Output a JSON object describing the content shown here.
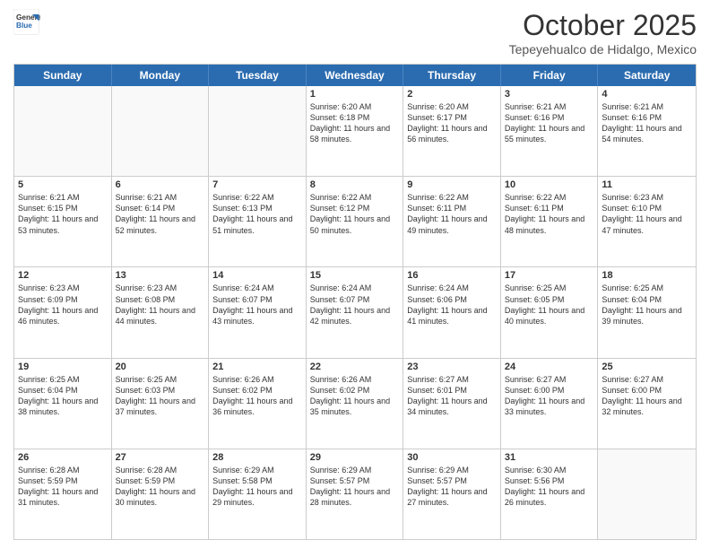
{
  "logo": {
    "line1": "General",
    "line2": "Blue"
  },
  "title": "October 2025",
  "location": "Tepeyehualco de Hidalgo, Mexico",
  "days_of_week": [
    "Sunday",
    "Monday",
    "Tuesday",
    "Wednesday",
    "Thursday",
    "Friday",
    "Saturday"
  ],
  "weeks": [
    [
      {
        "day": "",
        "empty": true
      },
      {
        "day": "",
        "empty": true
      },
      {
        "day": "",
        "empty": true
      },
      {
        "day": "1",
        "sunrise": "6:20 AM",
        "sunset": "6:18 PM",
        "daylight": "11 hours and 58 minutes."
      },
      {
        "day": "2",
        "sunrise": "6:20 AM",
        "sunset": "6:17 PM",
        "daylight": "11 hours and 56 minutes."
      },
      {
        "day": "3",
        "sunrise": "6:21 AM",
        "sunset": "6:16 PM",
        "daylight": "11 hours and 55 minutes."
      },
      {
        "day": "4",
        "sunrise": "6:21 AM",
        "sunset": "6:16 PM",
        "daylight": "11 hours and 54 minutes."
      }
    ],
    [
      {
        "day": "5",
        "sunrise": "6:21 AM",
        "sunset": "6:15 PM",
        "daylight": "11 hours and 53 minutes."
      },
      {
        "day": "6",
        "sunrise": "6:21 AM",
        "sunset": "6:14 PM",
        "daylight": "11 hours and 52 minutes."
      },
      {
        "day": "7",
        "sunrise": "6:22 AM",
        "sunset": "6:13 PM",
        "daylight": "11 hours and 51 minutes."
      },
      {
        "day": "8",
        "sunrise": "6:22 AM",
        "sunset": "6:12 PM",
        "daylight": "11 hours and 50 minutes."
      },
      {
        "day": "9",
        "sunrise": "6:22 AM",
        "sunset": "6:11 PM",
        "daylight": "11 hours and 49 minutes."
      },
      {
        "day": "10",
        "sunrise": "6:22 AM",
        "sunset": "6:11 PM",
        "daylight": "11 hours and 48 minutes."
      },
      {
        "day": "11",
        "sunrise": "6:23 AM",
        "sunset": "6:10 PM",
        "daylight": "11 hours and 47 minutes."
      }
    ],
    [
      {
        "day": "12",
        "sunrise": "6:23 AM",
        "sunset": "6:09 PM",
        "daylight": "11 hours and 46 minutes."
      },
      {
        "day": "13",
        "sunrise": "6:23 AM",
        "sunset": "6:08 PM",
        "daylight": "11 hours and 44 minutes."
      },
      {
        "day": "14",
        "sunrise": "6:24 AM",
        "sunset": "6:07 PM",
        "daylight": "11 hours and 43 minutes."
      },
      {
        "day": "15",
        "sunrise": "6:24 AM",
        "sunset": "6:07 PM",
        "daylight": "11 hours and 42 minutes."
      },
      {
        "day": "16",
        "sunrise": "6:24 AM",
        "sunset": "6:06 PM",
        "daylight": "11 hours and 41 minutes."
      },
      {
        "day": "17",
        "sunrise": "6:25 AM",
        "sunset": "6:05 PM",
        "daylight": "11 hours and 40 minutes."
      },
      {
        "day": "18",
        "sunrise": "6:25 AM",
        "sunset": "6:04 PM",
        "daylight": "11 hours and 39 minutes."
      }
    ],
    [
      {
        "day": "19",
        "sunrise": "6:25 AM",
        "sunset": "6:04 PM",
        "daylight": "11 hours and 38 minutes."
      },
      {
        "day": "20",
        "sunrise": "6:25 AM",
        "sunset": "6:03 PM",
        "daylight": "11 hours and 37 minutes."
      },
      {
        "day": "21",
        "sunrise": "6:26 AM",
        "sunset": "6:02 PM",
        "daylight": "11 hours and 36 minutes."
      },
      {
        "day": "22",
        "sunrise": "6:26 AM",
        "sunset": "6:02 PM",
        "daylight": "11 hours and 35 minutes."
      },
      {
        "day": "23",
        "sunrise": "6:27 AM",
        "sunset": "6:01 PM",
        "daylight": "11 hours and 34 minutes."
      },
      {
        "day": "24",
        "sunrise": "6:27 AM",
        "sunset": "6:00 PM",
        "daylight": "11 hours and 33 minutes."
      },
      {
        "day": "25",
        "sunrise": "6:27 AM",
        "sunset": "6:00 PM",
        "daylight": "11 hours and 32 minutes."
      }
    ],
    [
      {
        "day": "26",
        "sunrise": "6:28 AM",
        "sunset": "5:59 PM",
        "daylight": "11 hours and 31 minutes."
      },
      {
        "day": "27",
        "sunrise": "6:28 AM",
        "sunset": "5:59 PM",
        "daylight": "11 hours and 30 minutes."
      },
      {
        "day": "28",
        "sunrise": "6:29 AM",
        "sunset": "5:58 PM",
        "daylight": "11 hours and 29 minutes."
      },
      {
        "day": "29",
        "sunrise": "6:29 AM",
        "sunset": "5:57 PM",
        "daylight": "11 hours and 28 minutes."
      },
      {
        "day": "30",
        "sunrise": "6:29 AM",
        "sunset": "5:57 PM",
        "daylight": "11 hours and 27 minutes."
      },
      {
        "day": "31",
        "sunrise": "6:30 AM",
        "sunset": "5:56 PM",
        "daylight": "11 hours and 26 minutes."
      },
      {
        "day": "",
        "empty": true
      }
    ]
  ]
}
